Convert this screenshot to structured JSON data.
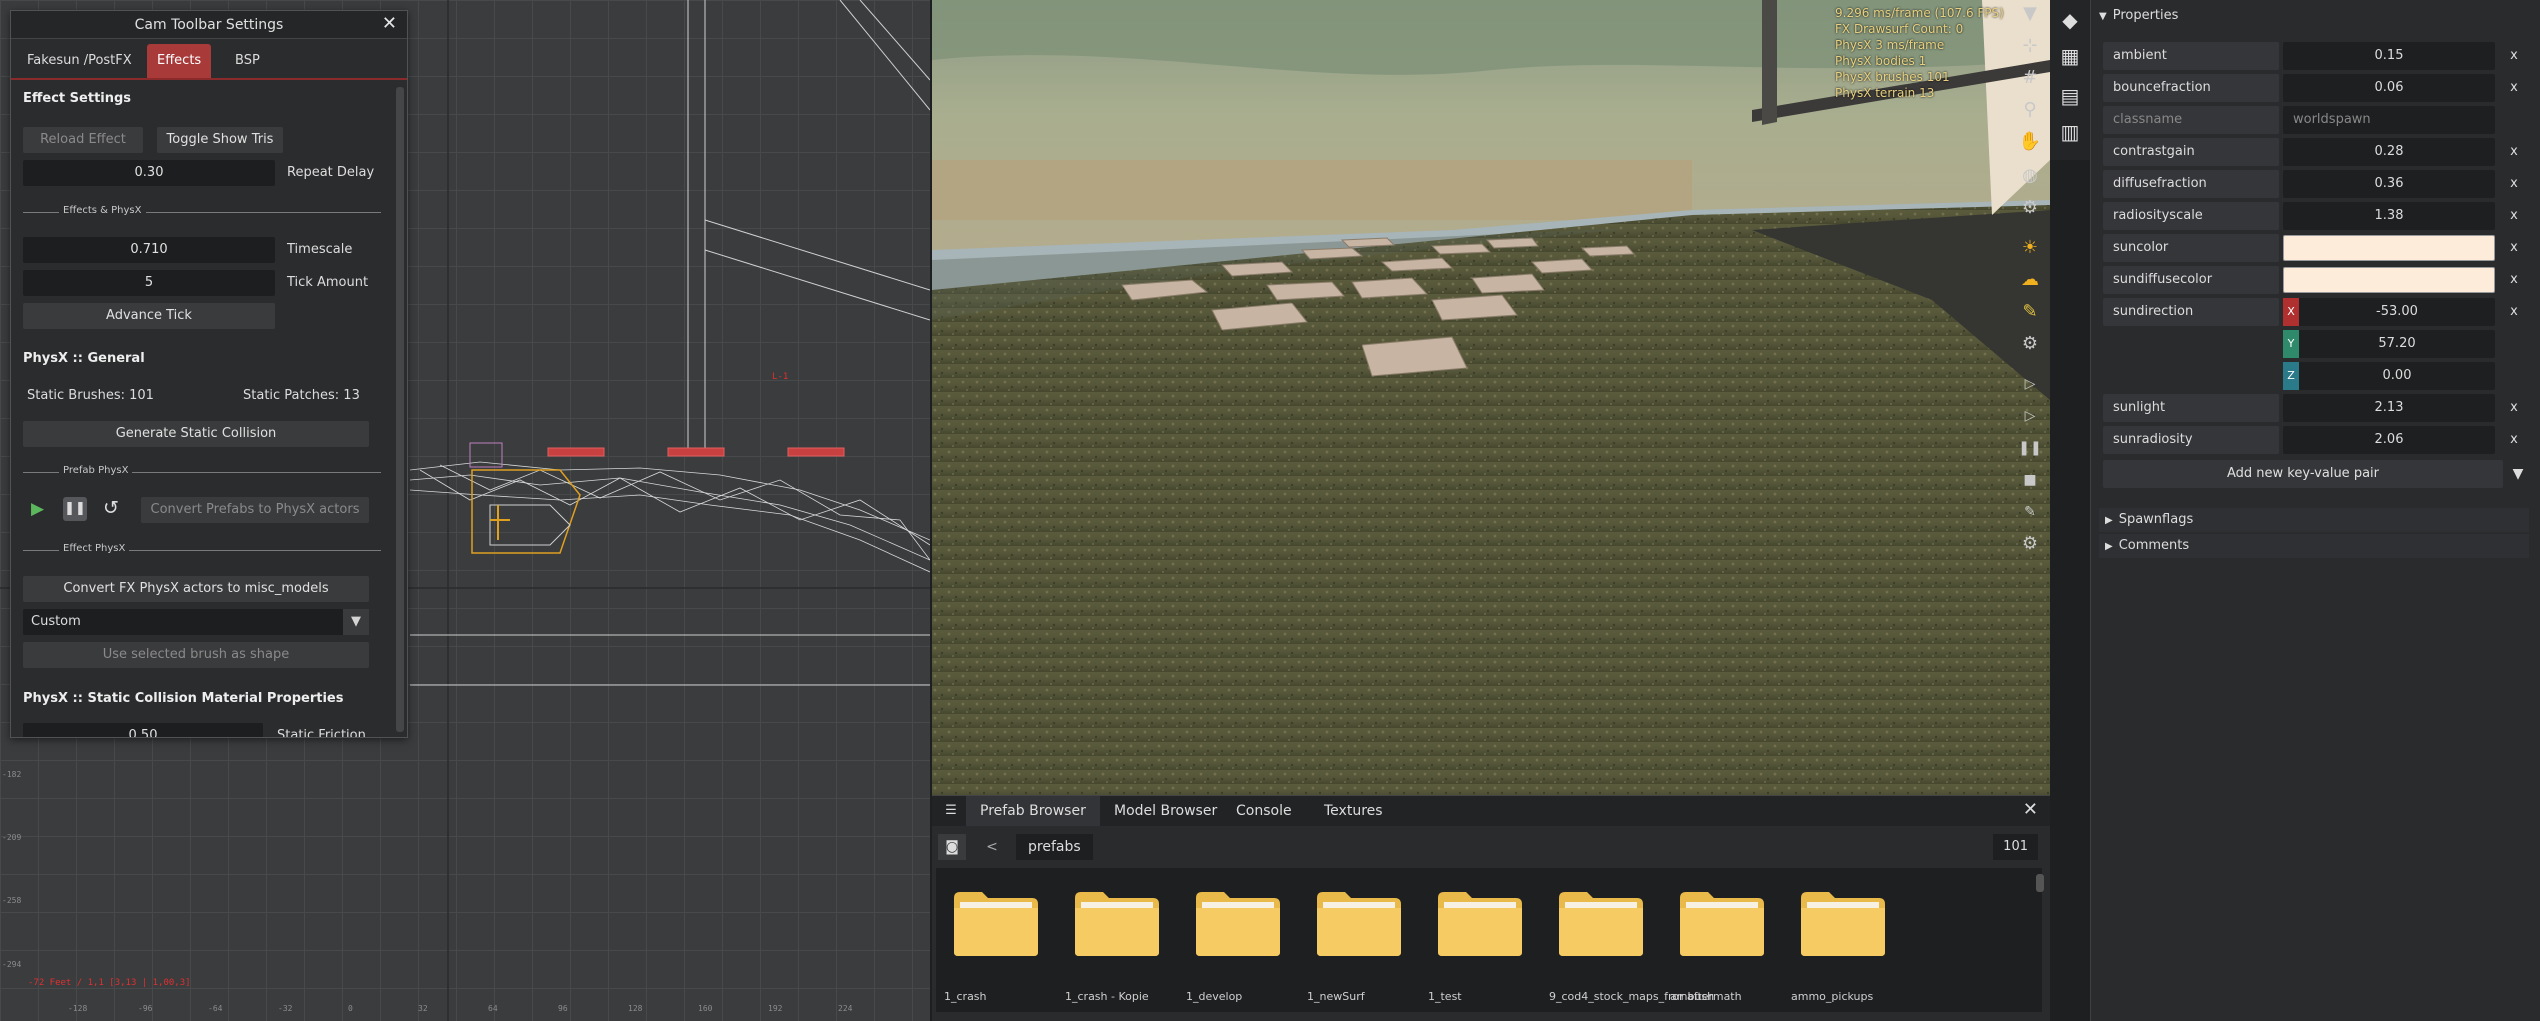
{
  "cam_panel": {
    "title": "Cam Toolbar Settings",
    "tabs": [
      {
        "label": "Fakesun /PostFX"
      },
      {
        "label": "Effects",
        "active": true
      },
      {
        "label": "BSP"
      }
    ],
    "effect_settings_header": "Effect Settings",
    "reload_effect_label": "Reload Effect",
    "toggle_show_tris_label": "Toggle Show Tris",
    "repeat_delay_value": "0.30",
    "repeat_delay_label": "Repeat Delay",
    "effects_physx_separator": "Effects & PhysX",
    "timescale_value": "0.710",
    "timescale_label": "Timescale",
    "tick_amount_value": "5",
    "tick_amount_label": "Tick Amount",
    "advance_tick_label": "Advance Tick",
    "physx_general_header": "PhysX :: General",
    "static_brushes": "Static Brushes: 101",
    "static_patches": "Static Patches: 13",
    "generate_static_collision_label": "Generate Static Collision",
    "prefab_physx_separator": "Prefab PhysX",
    "convert_prefabs_label": "Convert Prefabs to PhysX actors",
    "effect_physx_separator": "Effect PhysX",
    "convert_fx_label": "Convert FX PhysX actors to misc_models",
    "shape_select_value": "Custom",
    "use_selected_brush_label": "Use selected brush as shape",
    "static_collision_header": "PhysX :: Static Collision Material Properties",
    "static_friction_value": "0.50",
    "static_friction_label": "Static Friction"
  },
  "grid_view": {
    "red_label": "L-1",
    "coord_readout": "-72 Feet / 1,1 [3,13 | 1,00,3]",
    "ruler_left": [
      "-182",
      "-209",
      "-258",
      "-294"
    ],
    "ruler_bottom": [
      "-128",
      "-96",
      "-64",
      "-32",
      "0",
      "32",
      "64",
      "96",
      "128",
      "160",
      "192",
      "224"
    ]
  },
  "viewport": {
    "stats": [
      "9.296 ms/frame (107.6 FPS)",
      "FX Drawsurf Count: 0",
      "PhysX 3 ms/frame",
      "PhysX bodies 1",
      "PhysX brushes 101",
      "PhysX terrain 13"
    ]
  },
  "properties": {
    "header": "Properties",
    "rows": [
      {
        "key": "ambient",
        "value": "0.15"
      },
      {
        "key": "bouncefraction",
        "value": "0.06"
      },
      {
        "key": "classname",
        "value": "worldspawn"
      },
      {
        "key": "contrastgain",
        "value": "0.28"
      },
      {
        "key": "diffusefraction",
        "value": "0.36"
      },
      {
        "key": "radiosityscale",
        "value": "1.38"
      },
      {
        "key": "suncolor",
        "value": ""
      },
      {
        "key": "sundiffusecolor",
        "value": ""
      },
      {
        "key": "sundirection",
        "value": ""
      },
      {
        "key": "sunlight",
        "value": "2.13"
      },
      {
        "key": "sunradiosity",
        "value": "2.06"
      }
    ],
    "sundirection": {
      "x_label": "X",
      "x": "-53.00",
      "y_label": "Y",
      "y": "57.20",
      "z_label": "Z",
      "z": "0.00"
    },
    "remove_symbol": "x",
    "add_pair_label": "Add new key-value pair",
    "sections": [
      "Spawnflags",
      "Comments"
    ],
    "suncolor_hex": "#fdecd9",
    "sundiffusecolor_hex": "#fdecd9"
  },
  "browser": {
    "tabs": [
      {
        "label": "Prefab Browser",
        "active": true
      },
      {
        "label": "Model Browser"
      },
      {
        "label": "Console"
      },
      {
        "label": "Textures"
      }
    ],
    "back_symbol": "<",
    "path": "prefabs",
    "count": "101",
    "folders": [
      "1_crash",
      "1_crash - Kopie",
      "1_develop",
      "1_newSurf",
      "1_test",
      "9_cod4_stock_maps_fror aftermath",
      "ambush",
      "ammo_pickups"
    ]
  },
  "colors": {
    "accent_red": "#a83a3a",
    "folder_yellow": "#f6cb63",
    "axis_x": "#b03030",
    "axis_y": "#2e8a6a",
    "axis_z": "#2a7a8a"
  }
}
